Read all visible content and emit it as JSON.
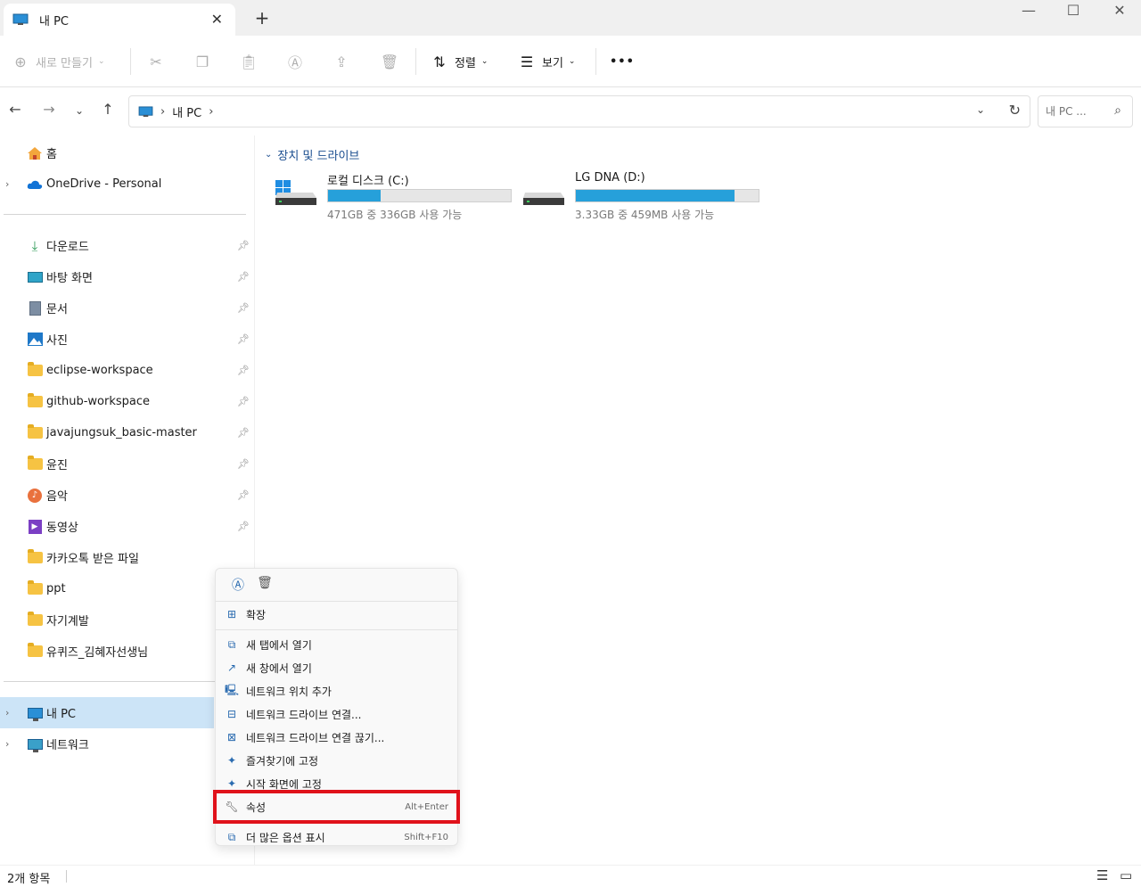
{
  "window": {
    "tab_title": "내 PC",
    "new_tab_glyph": "+",
    "close_tab_glyph": "✕",
    "minimize_glyph": "—",
    "maximize_glyph": "☐",
    "close_glyph": "✕"
  },
  "toolbar": {
    "new_label": "새로 만들기",
    "sort_label": "정렬",
    "view_label": "보기",
    "more_glyph": "•••"
  },
  "address": {
    "crumb": "내 PC",
    "separator": "›",
    "search_placeholder": "내 PC ..."
  },
  "sidebar": {
    "top_items": [
      {
        "label": "홈",
        "icon": "home-icon"
      },
      {
        "label": "OneDrive - Personal",
        "icon": "onedrive-icon"
      }
    ],
    "quick_access": [
      {
        "label": "다운로드",
        "icon": "download-icon"
      },
      {
        "label": "바탕 화면",
        "icon": "desktop-icon"
      },
      {
        "label": "문서",
        "icon": "document-icon"
      },
      {
        "label": "사진",
        "icon": "pictures-icon"
      },
      {
        "label": "eclipse-workspace",
        "icon": "folder-icon"
      },
      {
        "label": "github-workspace",
        "icon": "folder-icon"
      },
      {
        "label": "javajungsuk_basic-master",
        "icon": "folder-icon"
      },
      {
        "label": "윤진",
        "icon": "folder-icon"
      },
      {
        "label": "음악",
        "icon": "music-icon"
      },
      {
        "label": "동영상",
        "icon": "video-icon"
      },
      {
        "label": "카카오톡 받은 파일",
        "icon": "folder-icon"
      },
      {
        "label": "ppt",
        "icon": "folder-icon"
      },
      {
        "label": "자기계발",
        "icon": "folder-icon"
      },
      {
        "label": "유퀴즈_김혜자선생님",
        "icon": "folder-icon"
      }
    ],
    "bottom_items": [
      {
        "label": "내 PC",
        "icon": "pc-icon"
      },
      {
        "label": "네트워크",
        "icon": "network-icon"
      }
    ]
  },
  "content": {
    "group_title": "장치 및 드라이브",
    "drives": [
      {
        "name": "로컬 디스크 (C:)",
        "free_text": "471GB 중 336GB 사용 가능",
        "used_fraction": 0.29
      },
      {
        "name": "LG DNA (D:)",
        "free_text": "3.33GB 중 459MB 사용 가능",
        "used_fraction": 0.87
      }
    ]
  },
  "context_menu": {
    "items": [
      {
        "label": "확장",
        "icon": "expand-icon",
        "shortcut": ""
      },
      {
        "label": "새 탭에서 열기",
        "icon": "new-tab-icon",
        "shortcut": ""
      },
      {
        "label": "새 창에서 열기",
        "icon": "new-window-icon",
        "shortcut": ""
      },
      {
        "label": "네트워크 위치 추가",
        "icon": "network-location-icon",
        "shortcut": ""
      },
      {
        "label": "네트워크 드라이브 연결...",
        "icon": "map-drive-icon",
        "shortcut": ""
      },
      {
        "label": "네트워크 드라이브 연결 끊기...",
        "icon": "disconnect-drive-icon",
        "shortcut": ""
      },
      {
        "label": "즐겨찾기에 고정",
        "icon": "pin-icon",
        "shortcut": ""
      },
      {
        "label": "시작 화면에 고정",
        "icon": "pin-start-icon",
        "shortcut": ""
      },
      {
        "label": "속성",
        "icon": "wrench-icon",
        "shortcut": "Alt+Enter"
      },
      {
        "label": "더 많은 옵션 표시",
        "icon": "more-options-icon",
        "shortcut": "Shift+F10"
      }
    ]
  },
  "status": {
    "item_count": "2개 항목"
  },
  "colors": {
    "accent": "#26a0da",
    "selection": "#cce4f7",
    "highlight_box": "#e0121b"
  }
}
